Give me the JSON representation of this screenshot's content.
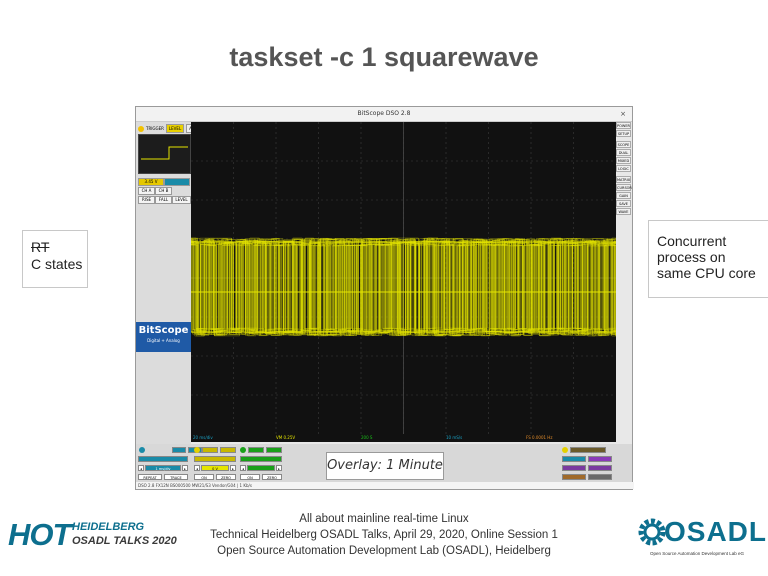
{
  "slide": {
    "title": "taskset -c 1 squarewave",
    "left_note": {
      "line1": "RT",
      "line2": "C states"
    },
    "right_note": {
      "line1": "Concurrent",
      "line2": "process on",
      "line3": "same CPU core"
    },
    "footer": {
      "line1": "All about mainline real-time Linux",
      "line2": "Technical Heidelberg OSADL Talks, April 29, 2020, Online Session 1",
      "line3": "Open Source Automation Development Lab (OSADL), Heidelberg"
    }
  },
  "hot_logo": {
    "mark": "HOT",
    "line1": "HEIDELBERG",
    "line2": "OSADL TALKS 2020"
  },
  "osadl_logo": {
    "word": "OSADL",
    "tagline": "Open Source Automation Development Lab eG"
  },
  "bitscope": {
    "window_title": "BitScope DSO 2.8",
    "close_label": "×",
    "trigger": {
      "label": "TRIGGER",
      "mode": "LEVEL",
      "auto": "AUTO"
    },
    "trigger_value": "3.45 V",
    "edge_buttons": [
      "RISE",
      "FALL",
      "LEVEL"
    ],
    "ch_buttons": [
      "CH A",
      "CH B"
    ],
    "logo_main": "BitScope",
    "logo_sub": "Digital + Analog",
    "right_buttons": [
      "POWER",
      "SETUP",
      "SCOPE",
      "DUAL",
      "MIXED",
      "LOGIC",
      "MATRIX",
      "CURSOR",
      "GAIN",
      "SAVE",
      "WAVE"
    ],
    "status_bar": [
      "20 ms/div",
      "VM 0.25V",
      "200 S",
      "10 mS/s",
      "FS 0.0001 Hz"
    ],
    "overlay_label": "Overlay: 1 Minute",
    "ctrl_labels": {
      "repeat": "REPEAT",
      "trace": "TRACE",
      "timebase": "1 ms/div",
      "offset": "0 V",
      "ch_a": "CH A",
      "ch_b": "CH B",
      "zero": "ZERO",
      "zoom": "ZOOM",
      "on": "ON"
    },
    "bottom_status": "DSO 2.8 FX12N BS000500 MW21/S3 Vendor/G04 | 1 Kb/s"
  },
  "colors": {
    "trace": "#e5e500",
    "grid": "#3c3c3c",
    "screen": "#111111",
    "accent": "#0d6f8e"
  }
}
